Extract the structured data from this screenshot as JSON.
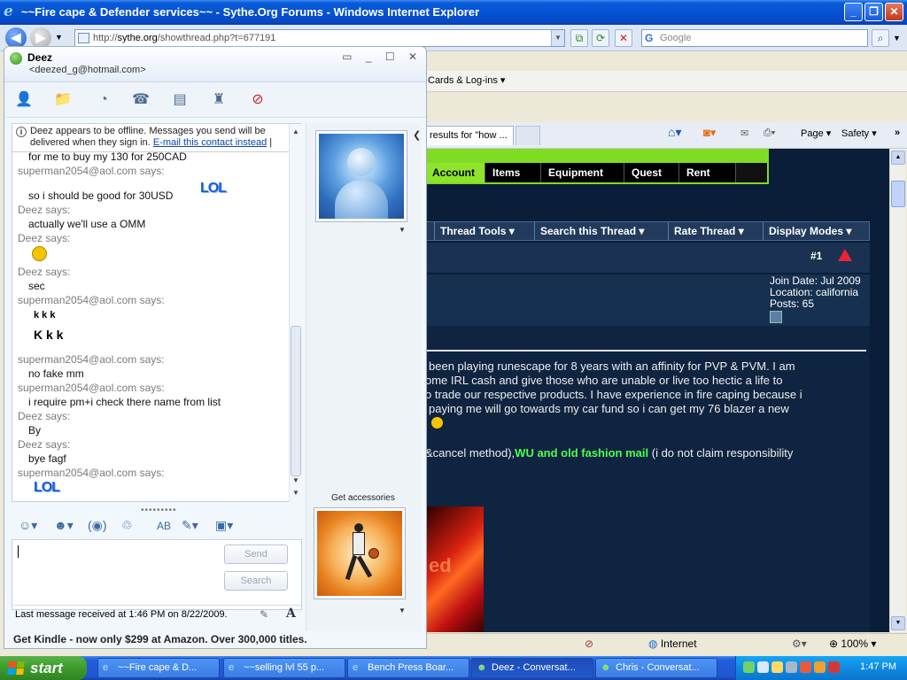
{
  "ie": {
    "title": "~~Fire cape & Defender services~~ - Sythe.Org Forums - Windows Internet Explorer",
    "url_prefix": "http://",
    "url_domain": "sythe.org",
    "url_path": "/showthread.php?t=677191",
    "search_placeholder": "Google",
    "menu_cards": "Cards & Log-ins",
    "tab_label": "results for \"how ...",
    "cmd_page": "Page",
    "cmd_safety": "Safety",
    "status_zone": "Internet",
    "zoom": "100%"
  },
  "site": {
    "nav_tabs": [
      "Account",
      "Items",
      "Equipment",
      "Quest",
      "Rent"
    ],
    "thread_tools": [
      "Thread Tools",
      "Search this Thread",
      "Rate Thread",
      "Display Modes"
    ],
    "post_number": "#1",
    "join_date": "Join Date: Jul 2009",
    "location": "Location: california",
    "posts": "Posts: 65",
    "post_lines": [
      "been playing runescape for 8 years with an affinity for PVP & PVM. I am",
      "ome IRL cash and give those who are unable or live too hectic a life to",
      "o trade our respective products. I have experience in fire caping because i",
      "paying me will go towards my car fund so i can get my 76 blazer a new",
      "l"
    ],
    "payment_prefix": "&cancel method),",
    "payment_green": "WU and old fashion mail",
    "payment_suffix": " (i do not claim responsibility"
  },
  "msn": {
    "contact_name": "Deez",
    "contact_email": "<deezed_g@hotmail.com>",
    "offline_note_1": "Deez appears to be offline. Messages you send will be",
    "offline_note_2": "delivered when they sign in. ",
    "offline_link": "E-mail this contact instead",
    "offline_pipe": " |",
    "chat": [
      {
        "kind": "msg",
        "text": "for me to buy my 130 for 250CAD"
      },
      {
        "kind": "says",
        "text": "superman2054@aol.com says:"
      },
      {
        "kind": "msg",
        "text": "so i should be good for 30USD"
      },
      {
        "kind": "says",
        "text": "Deez says:"
      },
      {
        "kind": "msg",
        "text": "actually we'll use a OMM"
      },
      {
        "kind": "says",
        "text": "Deez says:"
      },
      {
        "kind": "says",
        "text": "Deez says:"
      },
      {
        "kind": "msg",
        "text": "sec"
      },
      {
        "kind": "says",
        "text": "superman2054@aol.com says:"
      },
      {
        "kind": "says",
        "text": "superman2054@aol.com says:"
      },
      {
        "kind": "msg",
        "text": "no fake mm"
      },
      {
        "kind": "says",
        "text": "superman2054@aol.com says:"
      },
      {
        "kind": "msg",
        "text": "i require pm+i check there name from list"
      },
      {
        "kind": "says",
        "text": "Deez says:"
      },
      {
        "kind": "msg",
        "text": "By"
      },
      {
        "kind": "says",
        "text": "Deez says:"
      },
      {
        "kind": "msg",
        "text": "bye fagf"
      },
      {
        "kind": "says",
        "text": "superman2054@aol.com says:"
      }
    ],
    "lol_text": "LOL",
    "k_text_1": "k   k k",
    "k_text_2": "K  k k",
    "send_label": "Send",
    "search_label": "Search",
    "last_message": "Last message received at 1:46 PM on 8/22/2009.",
    "get_accessories": "Get accessories",
    "ad": "Get Kindle - now only $299 at Amazon.  Over 300,000 titles."
  },
  "taskbar": {
    "start": "start",
    "tasks": [
      "~~Fire cape & D...",
      "~~selling lvl 55 p...",
      "Bench Press Boar...",
      "Deez - Conversat...",
      "Chris - Conversat..."
    ],
    "clock": "1:47 PM"
  }
}
